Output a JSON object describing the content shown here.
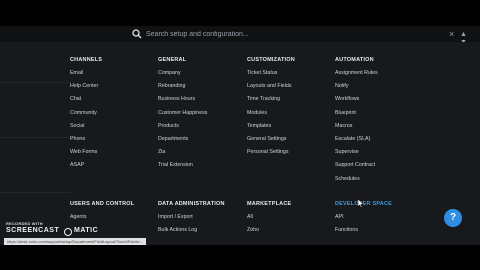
{
  "search": {
    "placeholder": "Search setup and configuration...",
    "close_symbol": "×"
  },
  "sections": {
    "channels": {
      "title": "CHANNELS",
      "items": [
        "Email",
        "Help Center",
        "Chat",
        "Community",
        "Social",
        "Phone",
        "Web Forms",
        "ASAP"
      ]
    },
    "general": {
      "title": "GENERAL",
      "items": [
        "Company",
        "Rebranding",
        "Business Hours",
        "Customer Happiness",
        "Products",
        "Departments",
        "Zia",
        "Trial Extension"
      ]
    },
    "customization": {
      "title": "CUSTOMIZATION",
      "items": [
        "Ticket Status",
        "Layouts and Fields",
        "Time Tracking",
        "Modules",
        "Templates",
        "General Settings",
        "Personal Settings"
      ]
    },
    "automation": {
      "title": "AUTOMATION",
      "items": [
        "Assignment Rules",
        "Notify",
        "Workflows",
        "Blueprint",
        "Macros",
        "Escalate (SLA)",
        "Supervise",
        "Support Contract",
        "Schedules"
      ]
    },
    "users_and_control": {
      "title": "USERS AND CONTROL",
      "items": [
        "Agents"
      ]
    },
    "data_administration": {
      "title": "DATA ADMINISTRATION",
      "items": [
        "Import / Export",
        "Bulk Actions Log"
      ]
    },
    "marketplace": {
      "title": "MARKETPLACE",
      "items": [
        "All",
        "Zoho"
      ]
    },
    "developer_space": {
      "title": "DEVELOPER SPACE",
      "items": [
        "API",
        "Functions"
      ]
    }
  },
  "help": {
    "label": "?"
  },
  "watermark": {
    "recorded": "RECORDED WITH",
    "brand": "SCREENCAST",
    "brand_suffix": "MATIC"
  },
  "status_url": "https://desk.zoho.com/support/setup/Department/FieldLayout/Ticket/Fields/..."
}
